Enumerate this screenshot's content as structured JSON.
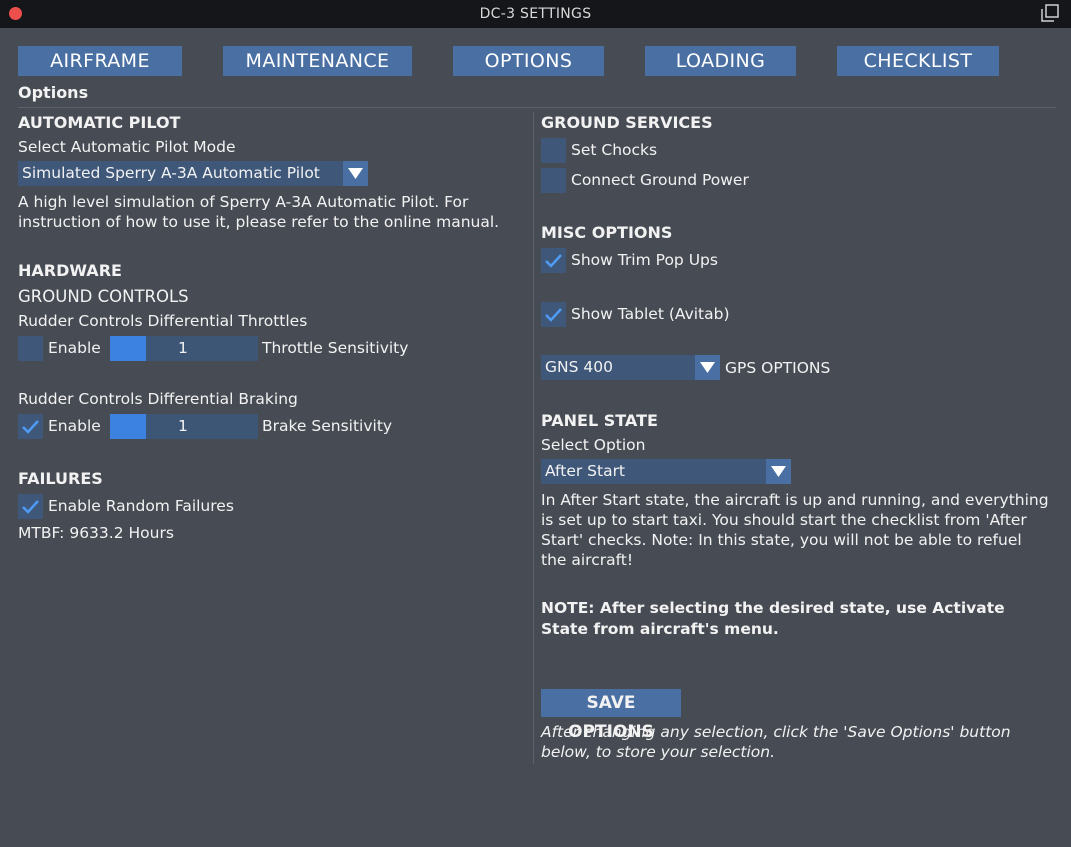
{
  "window": {
    "title": "DC-3 SETTINGS"
  },
  "tabs": [
    "AIRFRAME",
    "MAINTENANCE",
    "OPTIONS",
    "LOADING",
    "CHECKLIST"
  ],
  "section_label": "Options",
  "autopilot": {
    "heading": "AUTOMATIC PILOT",
    "mode_label": "Select Automatic Pilot Mode",
    "mode_value": "Simulated Sperry A-3A Automatic Pilot",
    "description": "A high level simulation of Sperry A-3A Automatic Pilot. For instruction of how to use it, please refer to the online manual."
  },
  "hardware": {
    "heading": "HARDWARE",
    "subheading": "GROUND CONTROLS",
    "throttles": {
      "label": "Rudder Controls Differential Throttles",
      "enable_label": "Enable",
      "enabled": false,
      "value": "1",
      "sensitivity_label": "Throttle Sensitivity"
    },
    "braking": {
      "label": "Rudder Controls Differential Braking",
      "enable_label": "Enable",
      "enabled": true,
      "value": "1",
      "sensitivity_label": "Brake Sensitivity"
    }
  },
  "failures": {
    "heading": "FAILURES",
    "random_label": "Enable Random Failures",
    "random_enabled": true,
    "mtbf": "MTBF: 9633.2 Hours"
  },
  "ground_services": {
    "heading": "GROUND SERVICES",
    "chocks_label": "Set Chocks",
    "chocks": false,
    "power_label": "Connect Ground Power",
    "power": false
  },
  "misc": {
    "heading": "MISC OPTIONS",
    "trim_label": "Show Trim Pop Ups",
    "trim": true,
    "tablet_label": "Show Tablet (Avitab)",
    "tablet": true,
    "gps_value": "GNS 400",
    "gps_label": "GPS OPTIONS"
  },
  "panel_state": {
    "heading": "PANEL STATE",
    "select_label": "Select Option",
    "value": "After Start",
    "description": "In After Start state, the aircraft is up and running, and everything is set up to start taxi. You should start the checklist from 'After Start' checks.  Note: In this state, you will not be able to refuel the aircraft!",
    "note": "NOTE: After selecting the desired state, use Activate State from aircraft's menu."
  },
  "save": {
    "button": "SAVE OPTIONS",
    "hint": "After changing any selection, click the 'Save Options' button below, to store your selection."
  },
  "colors": {
    "background": "#474c54",
    "titlebar": "#15161a",
    "accent": "#4a6fa3",
    "control": "#3f5779",
    "slider_fill": "#3c82e0",
    "check": "#4f9cf5",
    "close": "#ec4f4c"
  },
  "icons": [
    "close-dot-icon",
    "popout-window-icon",
    "checkmark-icon",
    "dropdown-arrow-icon"
  ]
}
